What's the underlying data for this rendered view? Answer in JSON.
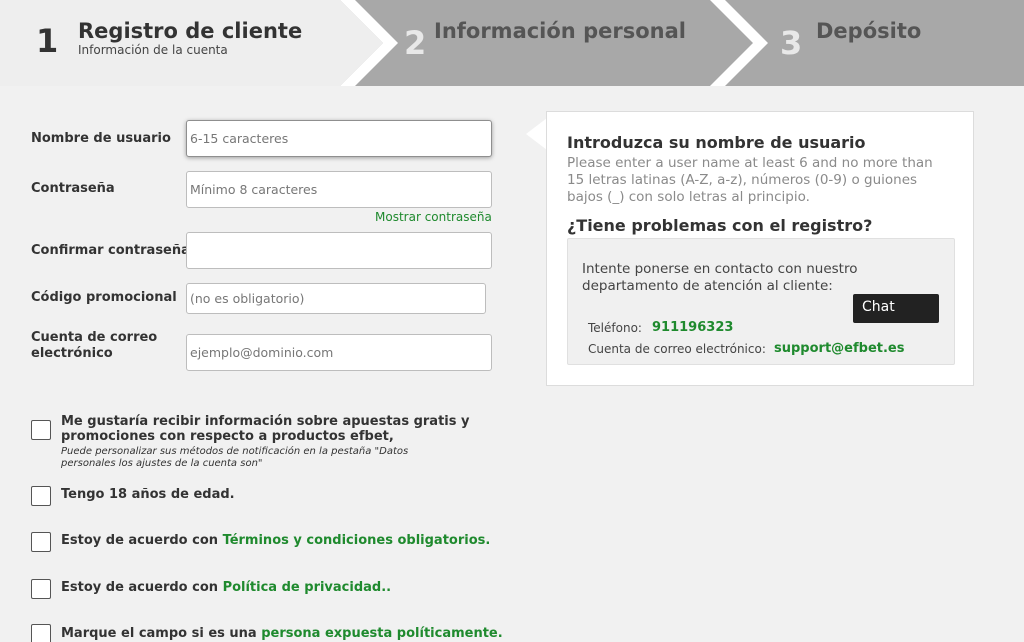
{
  "steps": [
    {
      "number": "1",
      "title": "Registro de cliente",
      "subtitle": "Información de la cuenta"
    },
    {
      "number": "2",
      "title": "Información personal"
    },
    {
      "number": "3",
      "title": "Depósito"
    }
  ],
  "form": {
    "username": {
      "label": "Nombre de usuario",
      "placeholder": "6-15 caracteres"
    },
    "password": {
      "label": "Contraseña",
      "placeholder": "Mínimo 8 caracteres",
      "show_link": "Mostrar contraseña"
    },
    "confirm": {
      "label": "Confirmar contraseña",
      "placeholder": ""
    },
    "promo": {
      "label": "Código promocional",
      "placeholder": "(no es obligatorio)"
    },
    "email": {
      "label_line1": "Cuenta de correo",
      "label_line2": "electrónico",
      "placeholder": "ejemplo@dominio.com"
    }
  },
  "checkboxes": {
    "newsletter": {
      "line1": "Me gustaría recibir información sobre apuestas gratis y",
      "line2": "promociones con respecto a productos efbet,",
      "note1": "Puede personalizar sus métodos de notificación en la pestaña \"Datos",
      "note2": "personales los ajustes de la cuenta son\""
    },
    "age": {
      "text": "Tengo 18 años de edad."
    },
    "terms": {
      "prefix": "Estoy de acuerdo con ",
      "link": "Términos y condiciones obligatorios."
    },
    "privacy": {
      "prefix": "Estoy de acuerdo con ",
      "link": "Política de privacidad.."
    },
    "pep": {
      "prefix": "Marque el campo si es una ",
      "link": "persona expuesta políticamente."
    }
  },
  "help_panel": {
    "title": "Introduzca su nombre de usuario",
    "desc_line1": "Please enter a user name at least 6 and no more than",
    "desc_line2": "15 letras latinas (A-Z, a-z), números (0-9) o guiones",
    "desc_line3": "bajos (_) con solo letras al principio.",
    "problems_title": "¿Tiene problemas con el registro?",
    "contact_text": "Intente ponerse en contacto con nuestro departamento de atención al cliente:",
    "phone_label": "Teléfono:",
    "phone": "911196323",
    "email_label": "Cuenta de correo electrónico:",
    "email": "support@efbet.es",
    "chat_label": "Chat"
  },
  "colors": {
    "accent_green": "#1f8a2e",
    "step_active_bg": "#f1f1f1",
    "step_inactive_bg": "#a8a8a8"
  }
}
